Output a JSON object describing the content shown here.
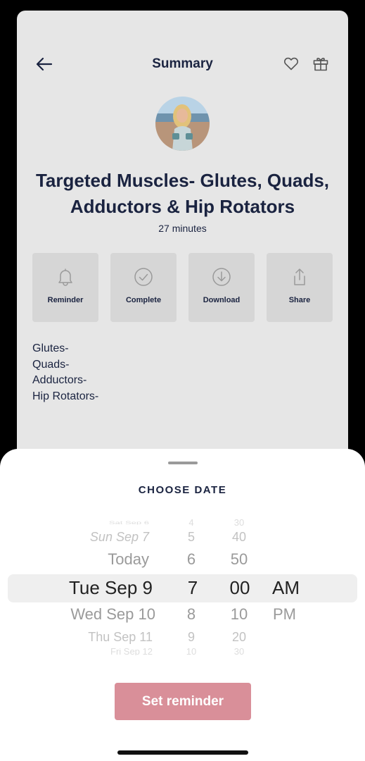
{
  "header": {
    "title": "Summary"
  },
  "workout": {
    "title": "Targeted Muscles- Glutes, Quads, Adductors & Hip Rotators",
    "duration": "27 minutes"
  },
  "actions": [
    {
      "label": "Reminder",
      "icon": "bell-icon"
    },
    {
      "label": "Complete",
      "icon": "check-circle-icon"
    },
    {
      "label": "Download",
      "icon": "download-icon"
    },
    {
      "label": "Share",
      "icon": "share-icon"
    }
  ],
  "muscles": [
    "Glutes-",
    "Quads-",
    "Adductors-",
    "Hip Rotators-"
  ],
  "sheet": {
    "title": "CHOOSE DATE",
    "picker": {
      "dates": [
        "Sat Sep 6",
        "Sun Sep 7",
        "Today",
        "Tue Sep 9",
        "Wed Sep 10",
        "Thu Sep 11",
        "Fri Sep 12"
      ],
      "hours": [
        "4",
        "5",
        "6",
        "7",
        "8",
        "9",
        "10"
      ],
      "minutes": [
        "30",
        "40",
        "50",
        "00",
        "10",
        "20",
        "30"
      ],
      "periods": [
        "AM",
        "PM"
      ],
      "selected": {
        "date": "Tue Sep 9",
        "hour": "7",
        "minute": "00",
        "period": "AM"
      }
    },
    "button_label": "Set reminder"
  },
  "colors": {
    "ink": "#1a2340",
    "button": "#d98f99",
    "card": "#e6e6e6",
    "tile": "#d6d6d6"
  }
}
